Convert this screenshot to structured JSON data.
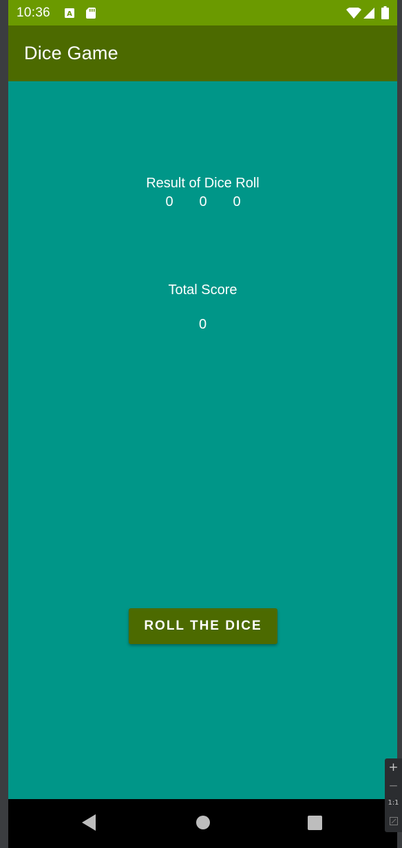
{
  "status_bar": {
    "time": "10:36",
    "icons": [
      "a-keyboard-icon",
      "sd-card-icon",
      "wifi-icon",
      "signal-icon",
      "battery-icon"
    ]
  },
  "app_bar": {
    "title": "Dice Game"
  },
  "main": {
    "result_label": "Result of Dice Roll",
    "dice": [
      "0",
      "0",
      "0"
    ],
    "total_label": "Total Score",
    "total_value": "0",
    "roll_button_label": "ROLL THE DICE"
  },
  "nav_bar": {
    "icons": [
      "back-icon",
      "home-icon",
      "recents-icon"
    ]
  },
  "zoom_controls": {
    "zoom_in": "+",
    "zoom_out": "−",
    "reset": "1:1"
  },
  "colors": {
    "status_bar": "#6b9a00",
    "app_bar": "#4c6a00",
    "background": "#009688",
    "button": "#4c6a00",
    "nav_bar": "#000000"
  }
}
